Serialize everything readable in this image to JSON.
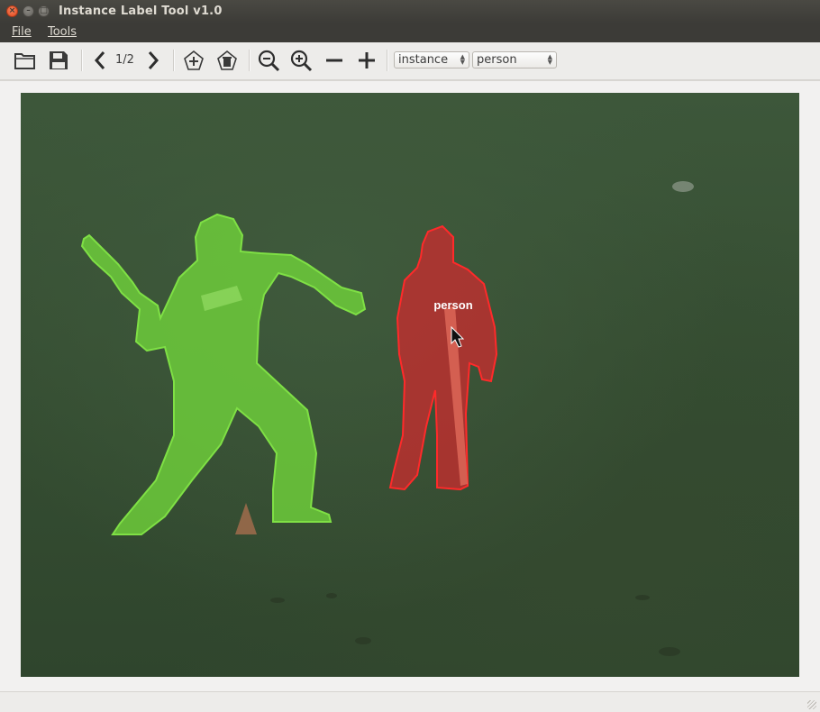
{
  "window": {
    "title": "Instance Label Tool v1.0"
  },
  "menu": {
    "file": "File",
    "tools": "Tools"
  },
  "toolbar": {
    "page_counter": "1/2",
    "mode_select": "instance",
    "class_select": "person"
  },
  "annotations": [
    {
      "label": "",
      "color": "#6fd13a"
    },
    {
      "label": "person",
      "color": "#e0242a"
    }
  ],
  "icons": [
    "open-folder-icon",
    "save-icon",
    "prev-icon",
    "next-icon",
    "add-polygon-icon",
    "delete-polygon-icon",
    "zoom-out-icon",
    "zoom-in-icon",
    "minus-icon",
    "plus-icon",
    "mouse-cursor-icon"
  ]
}
